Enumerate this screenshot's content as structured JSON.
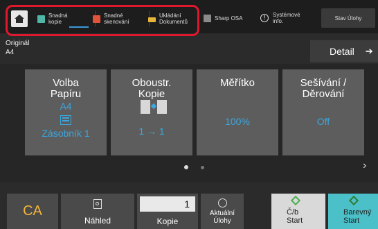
{
  "tabs": {
    "easy_copy": "Snadná\nkopie",
    "easy_scan": "Snadné\nskenování",
    "doc_save": "Ukládání\nDokumentů",
    "sharp_osa": "Sharp OSA",
    "system_info": "Systémové\ninfo.",
    "job_status": "Stav Úlohy"
  },
  "original": {
    "label": "Originál",
    "value": "A4"
  },
  "detail_label": "Detail",
  "tiles": [
    {
      "title": "Volba\nPapíru",
      "value": "A4",
      "extra": "Zásobník 1"
    },
    {
      "title": "Oboustr.\nKopie",
      "value": "1 → 1"
    },
    {
      "title": "Měřítko",
      "value": "100%"
    },
    {
      "title": "Sešívání /\nDěrování",
      "value": "Off"
    }
  ],
  "bottom": {
    "ca": "CA",
    "preview": "Náhled",
    "copies_label": "Kopie",
    "copies_value": "1",
    "current_jobs": "Aktuální\nÚlohy",
    "bw_start": "Č/b\nStart",
    "color_start": "Barevný\nStart"
  },
  "colors": {
    "highlight": "#e0182d",
    "accent": "#3aa7e0",
    "ca": "#f2b63a"
  }
}
